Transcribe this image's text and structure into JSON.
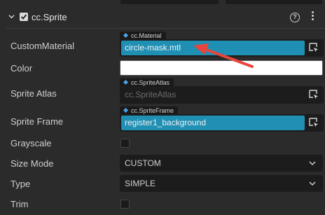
{
  "component": {
    "title": "cc.Sprite",
    "enabled": true
  },
  "properties": {
    "custom_material": {
      "label": "CustomMaterial",
      "type_tag": "cc.Material",
      "value": "circle-mask.mtl"
    },
    "color": {
      "label": "Color",
      "value": "#ffffff"
    },
    "sprite_atlas": {
      "label": "Sprite Atlas",
      "type_tag": "cc.SpriteAtlas",
      "value": "cc.SpriteAtlas"
    },
    "sprite_frame": {
      "label": "Sprite Frame",
      "type_tag": "cc.SpriteFrame",
      "value": "register1_background"
    },
    "grayscale": {
      "label": "Grayscale",
      "checked": false
    },
    "size_mode": {
      "label": "Size Mode",
      "value": "CUSTOM"
    },
    "type": {
      "label": "Type",
      "value": "SIMPLE"
    },
    "trim": {
      "label": "Trim",
      "checked": false
    }
  },
  "colors": {
    "asset_fill": "#1f8fb3",
    "annotation_arrow": "#e8453c",
    "asset_diamond": "#4aa3e8"
  }
}
